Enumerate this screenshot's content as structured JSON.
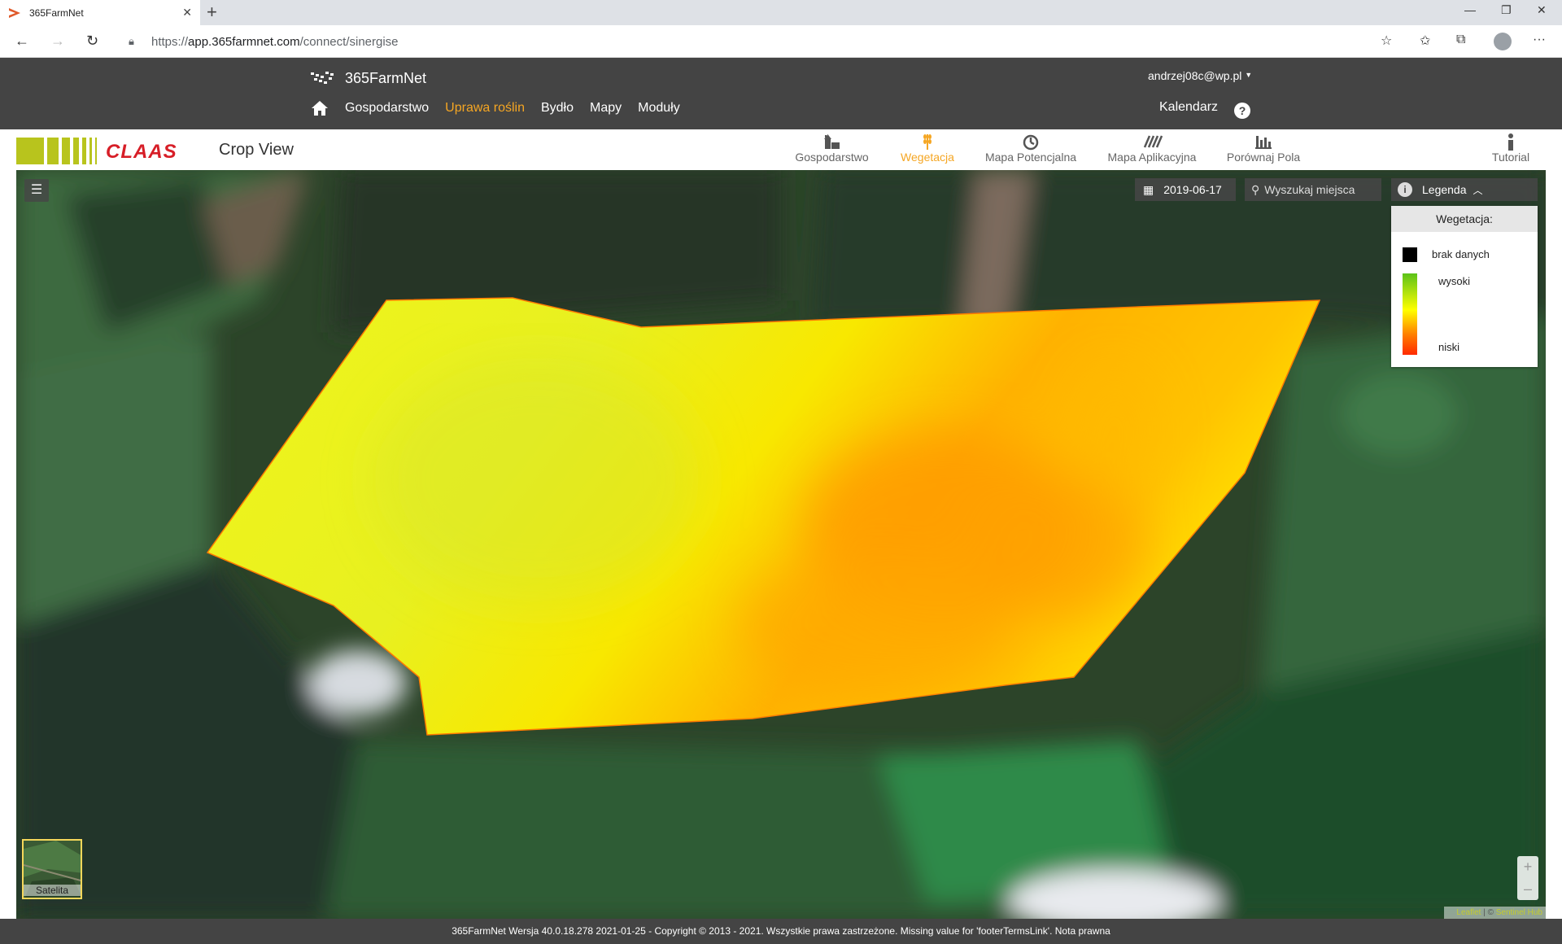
{
  "browser": {
    "tab_title": "365FarmNet",
    "new_tab": "+",
    "url_scheme": "https://",
    "url_domain": "app.365farmnet.com",
    "url_path": "/connect/sinergise"
  },
  "header": {
    "logo_text": "365FarmNet",
    "user_email": "andrzej08c@wp.pl",
    "nav": [
      {
        "label": "Gospodarstwo",
        "active": false
      },
      {
        "label": "Uprawa roślin",
        "active": true
      },
      {
        "label": "Bydło",
        "active": false
      },
      {
        "label": "Mapy",
        "active": false
      },
      {
        "label": "Moduły",
        "active": false
      }
    ],
    "calendar": "Kalendarz",
    "help": "?"
  },
  "cropview": {
    "brand": "CLAAS",
    "title": "Crop View",
    "tabs": [
      {
        "label": "Gospodarstwo",
        "icon": "farm-icon"
      },
      {
        "label": "Wegetacja",
        "icon": "wheat-icon"
      },
      {
        "label": "Mapa Potencjalna",
        "icon": "potential-map-icon"
      },
      {
        "label": "Mapa Aplikacyjna",
        "icon": "application-map-icon"
      },
      {
        "label": "Porównaj Pola",
        "icon": "compare-chart-icon"
      },
      {
        "label": "Tutorial",
        "icon": "info-icon"
      }
    ],
    "active_tab": "Wegetacja"
  },
  "map": {
    "date": "2019-06-17",
    "search_placeholder": "Wyszukaj miejsca",
    "legend_label": "Legenda",
    "legend": {
      "header": "Wegetacja:",
      "no_data": "brak danych",
      "high": "wysoki",
      "low": "niski",
      "no_data_color": "#000000",
      "gradient_colors": [
        "#5cc21a",
        "#ffff00",
        "#ff7f00",
        "#ff2a00"
      ]
    },
    "basemap_label": "Satelita",
    "zoom_in": "+",
    "zoom_out": "–",
    "attribution_leaflet": "Leaflet",
    "attribution_sep": " | © ",
    "attribution_hub": "Sentinel Hub"
  },
  "footer": {
    "text": "365FarmNet Wersja 40.0.18.278 2021-01-25 - Copyright © 2013 - 2021. Wszystkie prawa zastrzeżone.",
    "missing": "Missing value for 'footerTermsLink'.",
    "legal": "Nota prawna"
  },
  "colors": {
    "accent": "#f5a623",
    "header_bg": "#444444",
    "claas_red": "#d71e27",
    "claas_green": "#b8c41d"
  }
}
